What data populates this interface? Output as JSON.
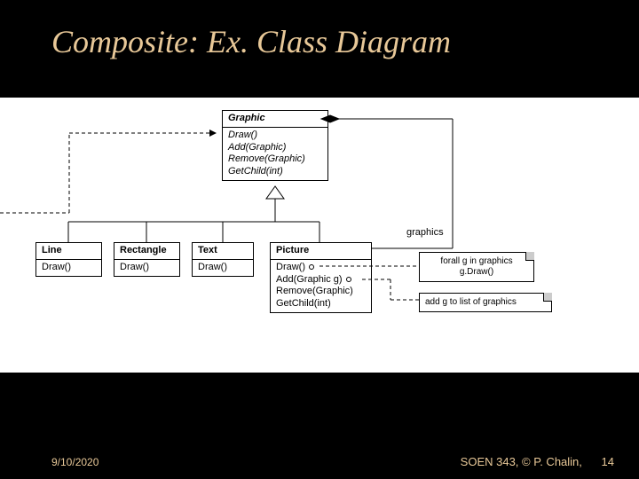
{
  "slide": {
    "title": "Composite: Ex. Class Diagram",
    "date": "9/10/2020",
    "course": "SOEN 343, © P. Chalin,",
    "page": "14"
  },
  "uml": {
    "graphic": {
      "name": "Graphic",
      "ops": [
        "Draw()",
        "Add(Graphic)",
        "Remove(Graphic)",
        "GetChild(int)"
      ]
    },
    "line": {
      "name": "Line",
      "ops": [
        "Draw()"
      ]
    },
    "rectangle": {
      "name": "Rectangle",
      "ops": [
        "Draw()"
      ]
    },
    "text": {
      "name": "Text",
      "ops": [
        "Draw()"
      ]
    },
    "picture": {
      "name": "Picture",
      "ops": [
        "Draw()",
        "Add(Graphic g)",
        "Remove(Graphic)",
        "GetChild(int)"
      ]
    },
    "assoc_label": "graphics",
    "note1": {
      "lines": [
        "forall g in graphics",
        "g.Draw()"
      ]
    },
    "note2": {
      "text": "add g to list of graphics"
    }
  }
}
